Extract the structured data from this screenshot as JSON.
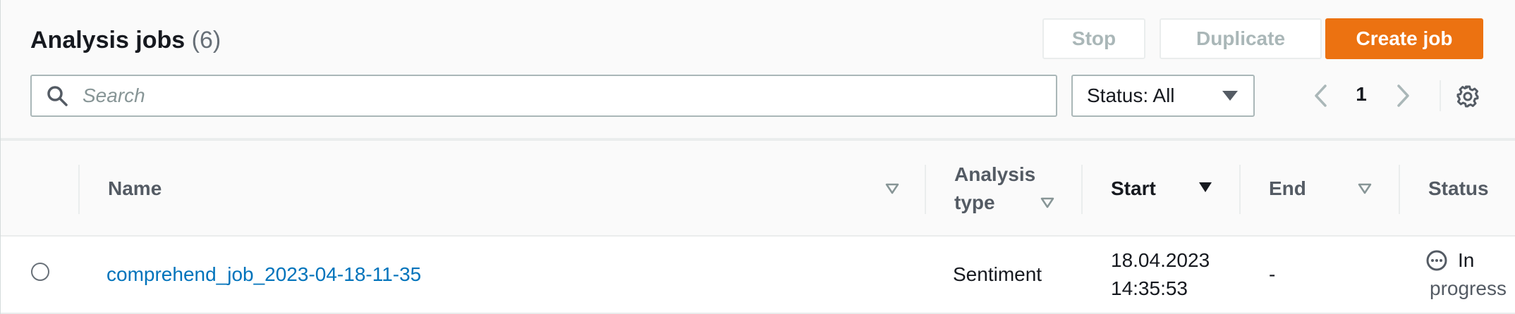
{
  "header": {
    "title": "Analysis jobs",
    "count": "(6)"
  },
  "actions": {
    "stop_label": "Stop",
    "duplicate_label": "Duplicate",
    "create_label": "Create job"
  },
  "search": {
    "placeholder": "Search",
    "value": ""
  },
  "filter": {
    "status_label": "Status: All"
  },
  "pagination": {
    "current_page": "1"
  },
  "icons": {
    "search": "search-icon",
    "dropdown": "caret-down-icon",
    "prev": "chevron-left-icon",
    "next": "chevron-right-icon",
    "settings": "gear-icon",
    "sort": "sort-caret-icon",
    "status": "ellipsis-circle-icon"
  },
  "table": {
    "columns": {
      "name": "Name",
      "analysis_type_line1": "Analysis",
      "analysis_type_line2": "type",
      "start": "Start",
      "end": "End",
      "status": "Status"
    },
    "sorted_column": "Start",
    "rows": [
      {
        "name": "comprehend_job_2023-04-18-11-35",
        "analysis_type": "Sentiment",
        "start_date": "18.04.2023",
        "start_time": "14:35:53",
        "end": "-",
        "status_line1": "In",
        "status_line2": "progress"
      }
    ]
  },
  "colors": {
    "primary": "#ec7211",
    "link": "#0073bb",
    "disabled_text": "#aab7b8",
    "border": "#aab7b8",
    "divider": "#eaeded"
  }
}
